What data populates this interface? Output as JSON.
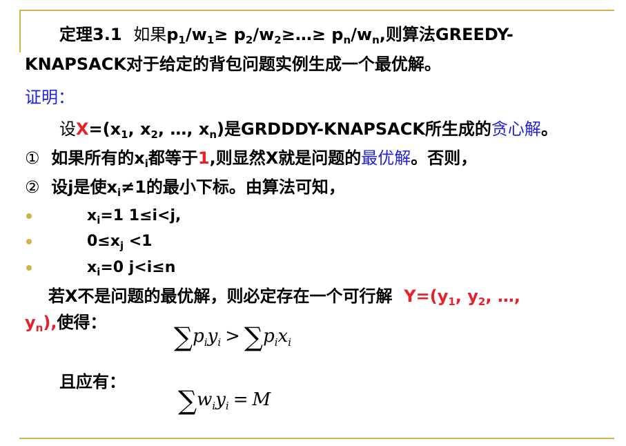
{
  "theorem": {
    "label": "定理3.1",
    "cond_if": "如果",
    "p": "p",
    "w": "w",
    "slash": "/",
    "sub_1": "1",
    "sub_2": "2",
    "sub_n": "n",
    "ge": "≥",
    "ge_dots": "≥…≥",
    "then_prefix": ",则算法",
    "alg_part1": "GREEDY-",
    "line2": "KNAPSACK对于给定的背包问题实例生成一个最优解。"
  },
  "proof_label": "证明：",
  "assume": {
    "prefix": "设",
    "X": "X",
    "eq_open": "=(x",
    "comma_x": ", x",
    "comma_dots_x": ", …, x",
    "close": ")",
    "mid": "是GRDDDY-KNAPSACK所生成的",
    "greedy_sol": "贪心解",
    "end": "。"
  },
  "case1": {
    "num": "①",
    "pre": "如果所有的x",
    "sub_i": "i",
    "mid": "都等于",
    "one": "1",
    "post": ",则显然X就是问题的",
    "optimal": "最优解",
    "end": "。否则，"
  },
  "case2": {
    "num": "②",
    "pre": "设j是使x",
    "sub_i": "i",
    "post": "≠1的最小下标。由算法可知，"
  },
  "bullets": [
    {
      "pre": "x",
      "sub": "i",
      "post": "=1  1≤i<j,"
    },
    {
      "pre": "0≤x",
      "sub": "j",
      "post": " <1"
    },
    {
      "pre": "x",
      "sub": "i",
      "post": "=0  j<i≤n"
    }
  ],
  "suppose": {
    "text": "若X不是问题的最优解，则必定存在一个可行解",
    "Y_open": "Y=(y",
    "comma_y": ", y",
    "comma_dots": ", …,",
    "y_n": "y",
    "close": "),",
    "tail": "使得："
  },
  "formula1": {
    "sigma": "∑",
    "p": "p",
    "y": "y",
    "x": "x",
    "sub": "i",
    "gt": ">"
  },
  "also": "且应有：",
  "formula2": {
    "sigma": "∑",
    "w": "w",
    "y": "y",
    "sub": "i",
    "eq": "=",
    "M": "M"
  },
  "colors": {
    "accent_line": "#d4b24a",
    "red": "#e8202a",
    "blue": "#2222dd"
  }
}
